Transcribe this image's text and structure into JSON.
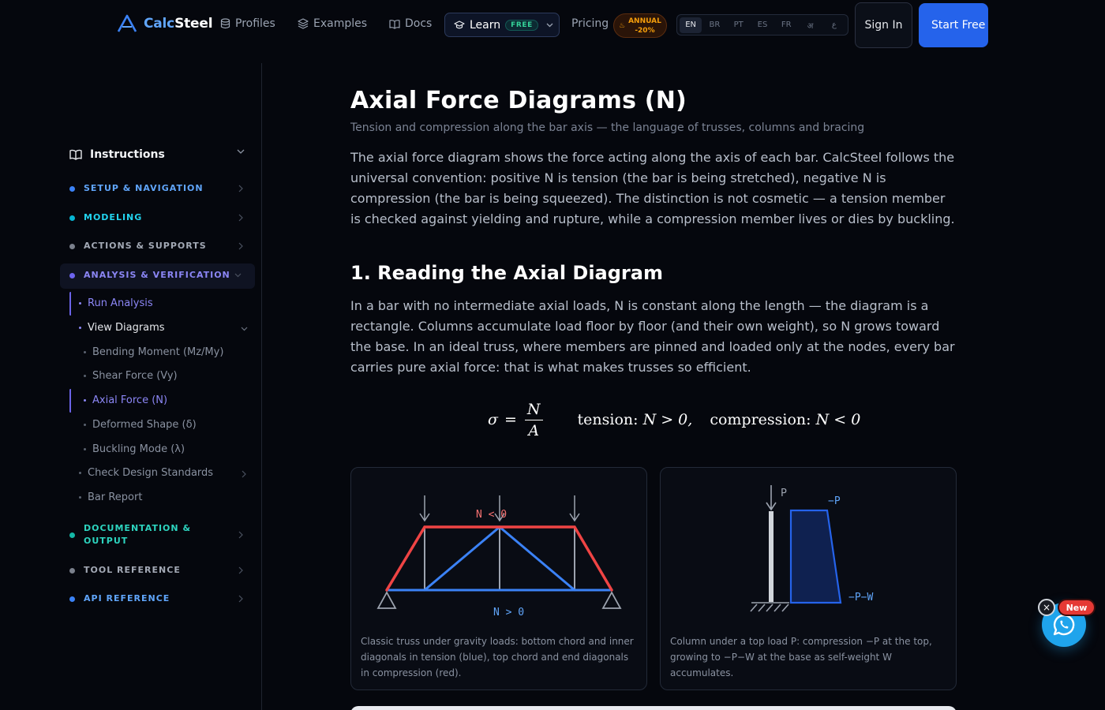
{
  "nav": {
    "brand_prefix": "Calc",
    "brand_suffix": "Steel",
    "links": [
      {
        "label": "Profiles",
        "icon": "database-icon"
      },
      {
        "label": "Examples",
        "icon": "layers-icon"
      },
      {
        "label": "Docs",
        "icon": "book-icon"
      }
    ],
    "learn_label": "Learn",
    "learn_badge": "FREE",
    "pricing_label": "Pricing",
    "annual_line1": "ANNUAL",
    "annual_line2": "-20%",
    "languages": [
      "EN",
      "BR",
      "PT",
      "ES",
      "FR",
      "अ",
      "ع"
    ],
    "active_language": "EN",
    "signin_label": "Sign In",
    "start_label": "Start Free"
  },
  "sidebar": {
    "title": "Instructions",
    "sections": [
      {
        "label": "SETUP & NAVIGATION",
        "color": "#60a5fa",
        "dot": "#3b82f6"
      },
      {
        "label": "MODELING",
        "color": "#22d3ee",
        "dot": "#06b6d4"
      },
      {
        "label": "ACTIONS & SUPPORTS",
        "color": "#a3a9b5",
        "dot": "#7a808c"
      },
      {
        "label": "ANALYSIS & VERIFICATION",
        "color": "#8b86f5",
        "dot": "#6d64ee"
      },
      {
        "label": "DOCUMENTATION & OUTPUT",
        "color": "#2dd4bf",
        "dot": "#14b8a6"
      },
      {
        "label": "TOOL REFERENCE",
        "color": "#a3a9b5",
        "dot": "#7a808c"
      },
      {
        "label": "API REFERENCE",
        "color": "#60a5fa",
        "dot": "#3b82f6"
      }
    ],
    "analysis_items": {
      "run_analysis": "Run Analysis",
      "view_diagrams": "View Diagrams",
      "diagrams": [
        "Bending Moment (Mz/My)",
        "Shear Force (Vy)",
        "Axial Force (N)",
        "Deformed Shape (δ)",
        "Buckling Mode (λ)"
      ],
      "check_design": "Check Design Standards",
      "bar_report": "Bar Report"
    }
  },
  "content": {
    "title": "Axial Force Diagrams (N)",
    "subtitle": "Tension and compression along the bar axis — the language of trusses, columns and bracing",
    "intro": "The axial force diagram shows the force acting along the axis of each bar. CalcSteel follows the universal convention: positive N is tension (the bar is being stretched), negative N is compression (the bar is being squeezed). The distinction is not cosmetic — a tension member is checked against yielding and rupture, while a compression member lives or dies by buckling.",
    "section1_title": "1. Reading the Axial Diagram",
    "section1_text": "In a bar with no intermediate axial loads, N is constant along the length — the diagram is a rectangle. Columns accumulate load floor by floor (and their own weight), so N grows toward the base. In an ideal truss, where members are pinned and loaded only at the nodes, every bar carries pure axial force: that is what makes trusses so efficient.",
    "formula": {
      "lhs": "σ",
      "eq": "=",
      "num": "N",
      "den": "A",
      "tension_label": "tension:",
      "tension_expr": "N > 0,",
      "compression_label": "compression:",
      "compression_expr": "N < 0"
    },
    "truss_card": {
      "top_label": "N < 0",
      "bottom_label": "N > 0",
      "caption": "Classic truss under gravity loads: bottom chord and inner diagonals in tension (blue), top chord and end diagonals in compression (red).",
      "tension_color": "#3b82f6",
      "compression_color": "#ef4444"
    },
    "column_card": {
      "load_label": "P",
      "top_label": "−P",
      "bottom_label": "−P−W",
      "caption": "Column under a top load P: compression −P at the top, growing to −P−W at the base as self-weight W accumulates."
    }
  },
  "floating": {
    "new_badge": "New",
    "close_glyph": "×",
    "chat_icon": "whatsapp-icon"
  }
}
